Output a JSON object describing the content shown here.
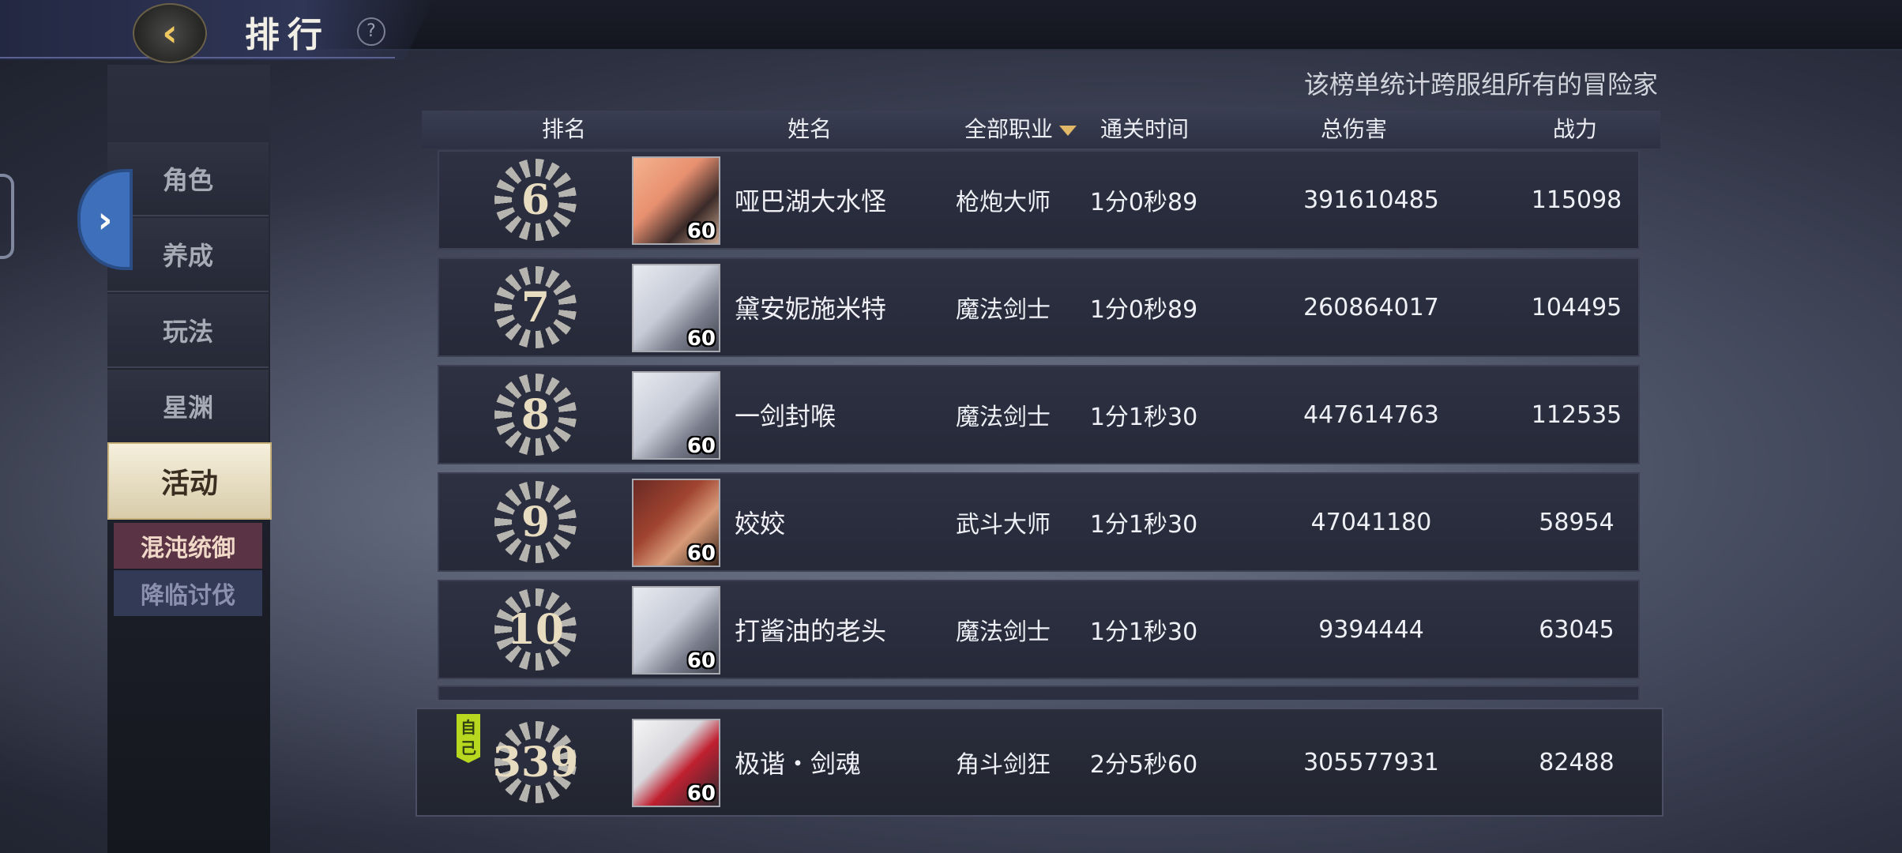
{
  "header": {
    "title": "排行",
    "back_icon": "back-arrow-icon",
    "help_icon": "?"
  },
  "subtitle": "该榜单统计跨服组所有的冒险家",
  "sidebar": {
    "tabs": [
      {
        "label": "角色",
        "active": false
      },
      {
        "label": "养成",
        "active": false
      },
      {
        "label": "玩法",
        "active": false
      },
      {
        "label": "星渊",
        "active": false
      },
      {
        "label": "活动",
        "active": true
      }
    ],
    "subtabs": [
      {
        "label": "混沌统御",
        "active": true
      },
      {
        "label": "降临讨伐",
        "active": false
      }
    ],
    "expand_icon": "chevron-right-icon"
  },
  "table": {
    "headers": {
      "rank": "排名",
      "name": "姓名",
      "job": "全部职业",
      "time": "通关时间",
      "damage": "总伤害",
      "power": "战力"
    },
    "rows": [
      {
        "rank": "6",
        "level": "60",
        "name": "哑巴湖大水怪",
        "job": "枪炮大师",
        "time": "1分0秒89",
        "damage": "391610485",
        "power": "115098"
      },
      {
        "rank": "7",
        "level": "60",
        "name": "黛安妮施米特",
        "job": "魔法剑士",
        "time": "1分0秒89",
        "damage": "260864017",
        "power": "104495"
      },
      {
        "rank": "8",
        "level": "60",
        "name": "一剑封喉",
        "job": "魔法剑士",
        "time": "1分1秒30",
        "damage": "447614763",
        "power": "112535"
      },
      {
        "rank": "9",
        "level": "60",
        "name": "姣姣",
        "job": "武斗大师",
        "time": "1分1秒30",
        "damage": "47041180",
        "power": "58954"
      },
      {
        "rank": "10",
        "level": "60",
        "name": "打酱油的老头",
        "job": "魔法剑士",
        "time": "1分1秒30",
        "damage": "9394444",
        "power": "63045"
      }
    ],
    "self_row": {
      "tag": "自己",
      "rank": "339",
      "level": "60",
      "name": "极谐・剑魂",
      "job": "角斗剑狂",
      "time": "2分5秒60",
      "damage": "305577931",
      "power": "82488"
    }
  },
  "colors": {
    "accent_gold": "#e0b868",
    "self_tag": "#b8d820",
    "expand_button": "#3e6fba"
  }
}
